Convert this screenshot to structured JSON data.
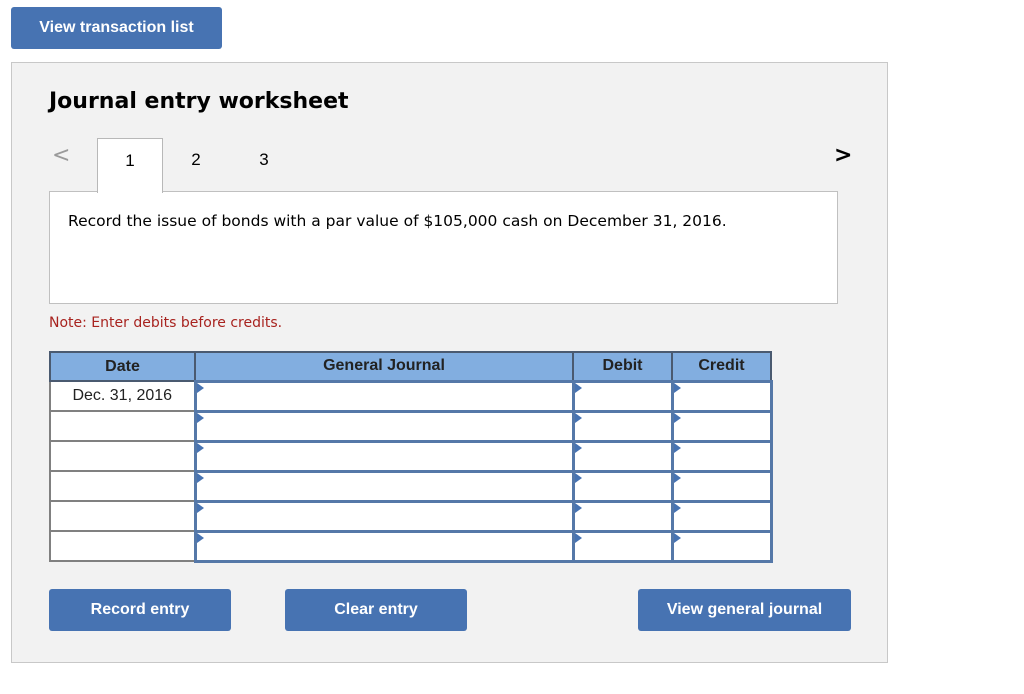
{
  "top_button": {
    "label": "View transaction list"
  },
  "worksheet": {
    "title": "Journal entry worksheet",
    "nav": {
      "prev_icon": "chevron-left-icon",
      "next_icon": "chevron-right-icon",
      "prev_glyph": "<",
      "next_glyph": ">"
    },
    "tabs": [
      {
        "label": "1",
        "active": true
      },
      {
        "label": "2",
        "active": false
      },
      {
        "label": "3",
        "active": false
      }
    ],
    "description": "Record the issue of bonds with a par value of $105,000 cash on December 31, 2016.",
    "note": "Note: Enter debits before credits.",
    "table": {
      "headers": [
        "Date",
        "General Journal",
        "Debit",
        "Credit"
      ],
      "rows": [
        {
          "date": "Dec. 31, 2016",
          "account": "",
          "debit": "",
          "credit": ""
        },
        {
          "date": "",
          "account": "",
          "debit": "",
          "credit": ""
        },
        {
          "date": "",
          "account": "",
          "debit": "",
          "credit": ""
        },
        {
          "date": "",
          "account": "",
          "debit": "",
          "credit": ""
        },
        {
          "date": "",
          "account": "",
          "debit": "",
          "credit": ""
        },
        {
          "date": "",
          "account": "",
          "debit": "",
          "credit": ""
        }
      ]
    },
    "buttons": {
      "record": "Record entry",
      "clear": "Clear entry",
      "view_journal": "View general journal"
    }
  },
  "colors": {
    "button_blue": "#4773b2",
    "header_blue": "#82aee0",
    "note_red": "#a8231f",
    "panel_bg": "#f2f2f2"
  }
}
